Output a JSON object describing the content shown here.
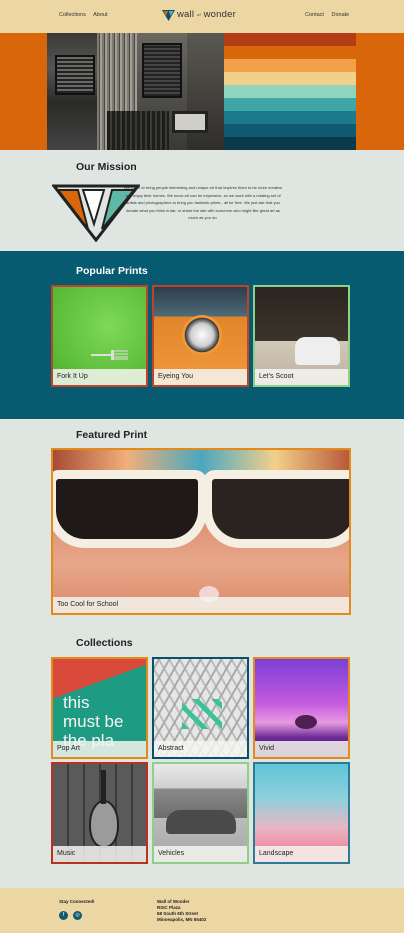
{
  "header": {
    "nav_left": [
      "Collections",
      "About"
    ],
    "nav_right": [
      "Contact",
      "Donate"
    ],
    "logo": {
      "word1": "wall",
      "word2": "of",
      "word3": "wonder"
    }
  },
  "mission": {
    "title": "Our Mission",
    "text": "We strive to bring people interesting and unique art that inspires them to be more creative and enjoy their homes. We know art can be expensive, so we work with a rotating set of artists and photographers to bring you fantastic prints - all for free. We just ask that you donate what you think is fair, or share the site with someone who might like great art as much as you do."
  },
  "popular": {
    "title": "Popular Prints",
    "items": [
      {
        "label": "Fork It Up",
        "border": "#c0422b"
      },
      {
        "label": "Eyeing You",
        "border": "#c0422b"
      },
      {
        "label": "Let's Scoot",
        "border": "#8fcf8a"
      }
    ]
  },
  "featured": {
    "title": "Featured Print",
    "label": "Too Cool for School",
    "border": "#e38a1c"
  },
  "collections": {
    "title": "Collections",
    "items": [
      {
        "label": "Pop Art",
        "border": "#e38a1c"
      },
      {
        "label": "Abstract",
        "border": "#0b4f6b"
      },
      {
        "label": "Vivid",
        "border": "#e38a1c"
      },
      {
        "label": "Music",
        "border": "#b83220"
      },
      {
        "label": "Vehicles",
        "border": "#8fcf8a"
      },
      {
        "label": "Landscape",
        "border": "#2a7b93"
      }
    ],
    "pop_art_text": [
      "this",
      "must be",
      "the pla"
    ]
  },
  "footer": {
    "stay": "Stay Connected!",
    "address": [
      "Wall of Wonder",
      "RSIC Plaza",
      "68 South 6th Street",
      "Minneapolis, MN 55402"
    ],
    "social": [
      {
        "icon": "facebook-icon",
        "glyph": "f"
      },
      {
        "icon": "instagram-icon",
        "glyph": "◎"
      }
    ]
  },
  "colors": {
    "header": "#ecd7a4",
    "hero_bg": "#d9660b",
    "popular_bg": "#075b70",
    "page_bg": "#dfe5e1"
  }
}
